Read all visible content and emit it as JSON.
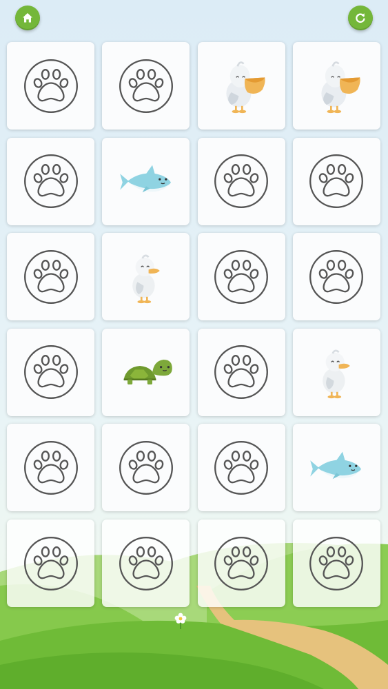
{
  "toolbar": {
    "home_icon": "home-icon",
    "restart_icon": "restart-icon",
    "button_color": "#74b73a"
  },
  "board": {
    "rows": 6,
    "cols": 4,
    "card_back_icon": "paw-icon",
    "cards": [
      {
        "state": "hidden",
        "face": "paw"
      },
      {
        "state": "hidden",
        "face": "paw"
      },
      {
        "state": "revealed",
        "face": "pelican"
      },
      {
        "state": "revealed",
        "face": "pelican"
      },
      {
        "state": "hidden",
        "face": "paw"
      },
      {
        "state": "revealed",
        "face": "shark"
      },
      {
        "state": "hidden",
        "face": "paw"
      },
      {
        "state": "hidden",
        "face": "paw"
      },
      {
        "state": "hidden",
        "face": "paw"
      },
      {
        "state": "revealed",
        "face": "duck"
      },
      {
        "state": "hidden",
        "face": "paw"
      },
      {
        "state": "hidden",
        "face": "paw"
      },
      {
        "state": "hidden",
        "face": "paw"
      },
      {
        "state": "revealed",
        "face": "turtle"
      },
      {
        "state": "hidden",
        "face": "paw"
      },
      {
        "state": "revealed",
        "face": "duck"
      },
      {
        "state": "hidden",
        "face": "paw"
      },
      {
        "state": "hidden",
        "face": "paw"
      },
      {
        "state": "hidden",
        "face": "paw"
      },
      {
        "state": "revealed",
        "face": "shark"
      },
      {
        "state": "hidden",
        "face": "paw"
      },
      {
        "state": "hidden",
        "face": "paw"
      },
      {
        "state": "hidden",
        "face": "paw"
      },
      {
        "state": "hidden",
        "face": "paw"
      }
    ]
  },
  "scene": {
    "sky_color": "#dcecf6",
    "grass_color": "#7cc242",
    "path_color": "#e6c27d",
    "flower_icon": "flower-icon"
  }
}
